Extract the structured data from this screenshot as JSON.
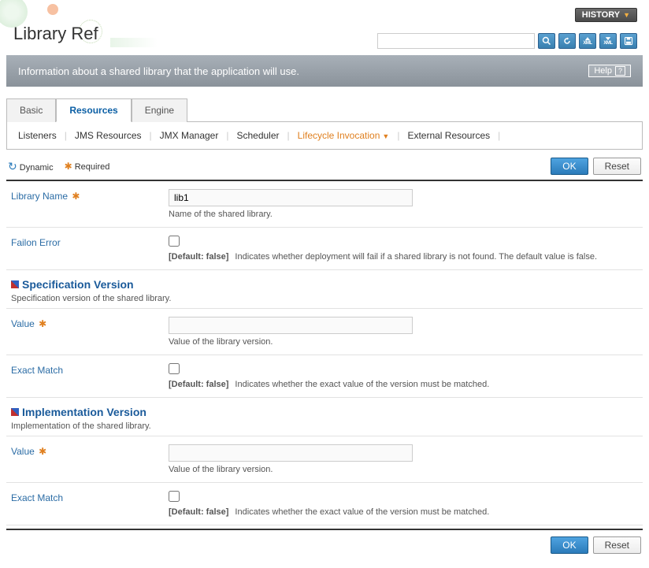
{
  "page_title": "Library Ref",
  "history_label": "HISTORY",
  "search_placeholder": "",
  "info_bar_text": "Information about a shared library that the application will use.",
  "help_label": "Help",
  "tabs": {
    "basic": "Basic",
    "resources": "Resources",
    "engine": "Engine"
  },
  "subtabs": {
    "listeners": "Listeners",
    "jms": "JMS Resources",
    "jmx": "JMX Manager",
    "scheduler": "Scheduler",
    "lifecycle": "Lifecycle Invocation",
    "external": "External Resources"
  },
  "legend": {
    "dynamic": "Dynamic",
    "required": "Required"
  },
  "buttons": {
    "ok": "OK",
    "reset": "Reset"
  },
  "fields": {
    "library_name": {
      "label": "Library Name",
      "value": "lib1",
      "help": "Name of the shared library."
    },
    "failon_error": {
      "label": "Failon Error",
      "default": "[Default: false]",
      "help": "Indicates whether deployment will fail if a shared library is not found. The default value is false."
    }
  },
  "sections": {
    "spec": {
      "title": "Specification Version",
      "desc": "Specification version of the shared library.",
      "value": {
        "label": "Value",
        "value": "",
        "help": "Value of the library version."
      },
      "exact": {
        "label": "Exact Match",
        "default": "[Default: false]",
        "help": "Indicates whether the exact value of the version must be matched."
      }
    },
    "impl": {
      "title": "Implementation Version",
      "desc": "Implementation of the shared library.",
      "value": {
        "label": "Value",
        "value": "",
        "help": "Value of the library version."
      },
      "exact": {
        "label": "Exact Match",
        "default": "[Default: false]",
        "help": "Indicates whether the exact value of the version must be matched."
      }
    }
  }
}
